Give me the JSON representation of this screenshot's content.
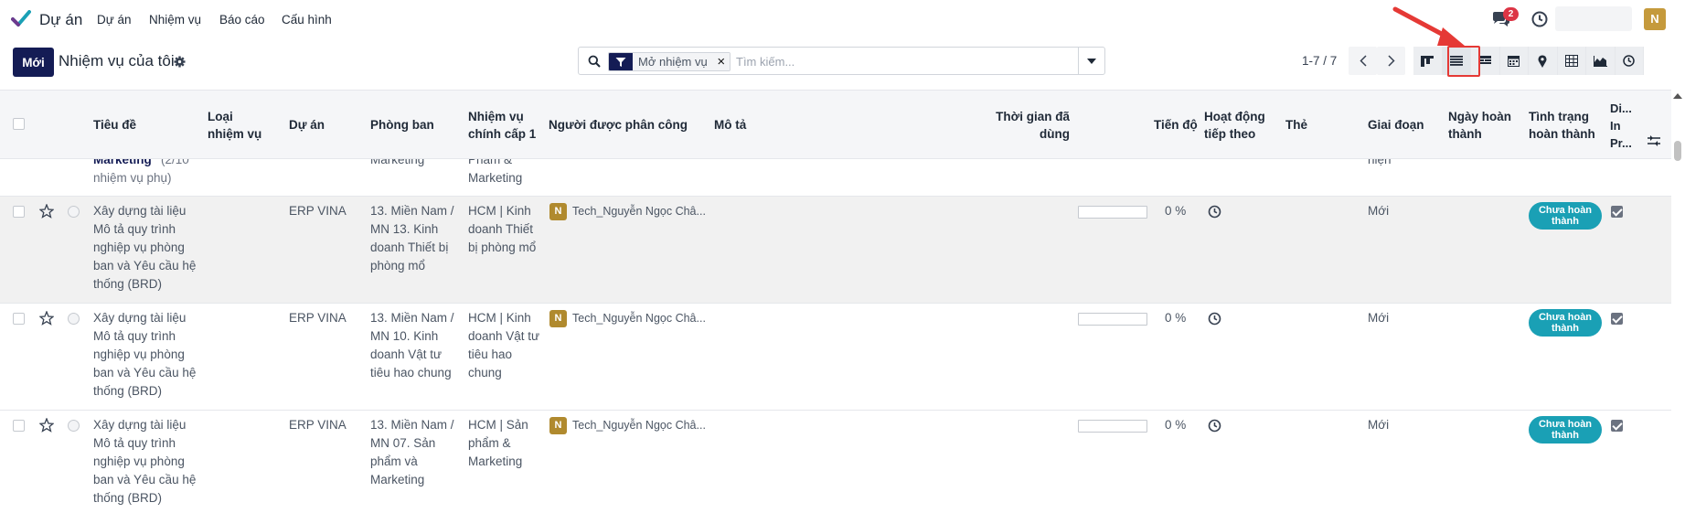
{
  "nav": {
    "app_name": "Dự án",
    "menus": [
      "Dự án",
      "Nhiệm vụ",
      "Báo cáo",
      "Cấu hình"
    ],
    "chat_count": "2",
    "user_initial": "N"
  },
  "control": {
    "new_label": "Mới",
    "title": "Nhiệm vụ của tôi",
    "facet_label": "Mở nhiệm vụ",
    "search_placeholder": "Tìm kiếm...",
    "pager": "1-7 / 7"
  },
  "views": [
    "kanban-icon",
    "list-icon",
    "activity-icon",
    "calendar-icon",
    "map-pin-icon",
    "pivot-icon",
    "graph-icon",
    "clock-icon"
  ],
  "columns": {
    "title": "Tiêu đề",
    "type": "Loại nhiệm vụ",
    "project": "Dự án",
    "department": "Phòng ban",
    "parent_task": "Nhiệm vụ chính cấp 1",
    "assignee": "Người được phân công",
    "description": "Mô tả",
    "time_spent": "Thời gian đã dùng",
    "progress": "Tiến độ",
    "next_activity": "Hoạt động tiếp theo",
    "tags": "Thẻ",
    "stage": "Giai đoạn",
    "done_date": "Ngày hoàn thành",
    "done_status": "Tình trạng hoàn thành",
    "extra": "Di... In Pr..."
  },
  "partial_row": {
    "title": "Marketing",
    "subtasks": "(2/10",
    "subtasks_2": "nhiệm vụ phụ)",
    "department": "Marketing",
    "parent_task_1": "Phẩm &",
    "parent_task_2": "Marketing",
    "stage": "hiện"
  },
  "rows": [
    {
      "title": [
        "Xây dựng tài liệu",
        "Mô tả quy trình",
        "nghiệp vụ phòng",
        "ban và Yêu cầu hệ",
        "thống (BRD)"
      ],
      "project": "ERP VINA",
      "department": [
        "13. Miền Nam /",
        "MN 13. Kinh",
        "doanh Thiết bị",
        "phòng mổ"
      ],
      "parent_task": [
        "HCM | Kinh",
        "doanh Thiết",
        "bị phòng mổ"
      ],
      "assignee_initial": "N",
      "assignee": "Tech_Nguyễn Ngọc Châ...",
      "progress": "0 %",
      "stage": "Mới",
      "status": "Chưa hoàn thành"
    },
    {
      "title": [
        "Xây dựng tài liệu",
        "Mô tả quy trình",
        "nghiệp vụ phòng",
        "ban và Yêu cầu hệ",
        "thống (BRD)"
      ],
      "project": "ERP VINA",
      "department": [
        "13. Miền Nam /",
        "MN 10. Kinh",
        "doanh Vật tư",
        "tiêu hao chung"
      ],
      "parent_task": [
        "HCM | Kinh",
        "doanh Vật tư",
        "tiêu hao",
        "chung"
      ],
      "assignee_initial": "N",
      "assignee": "Tech_Nguyễn Ngọc Châ...",
      "progress": "0 %",
      "stage": "Mới",
      "status": "Chưa hoàn thành"
    },
    {
      "title": [
        "Xây dựng tài liệu",
        "Mô tả quy trình",
        "nghiệp vụ phòng",
        "ban và Yêu cầu hệ",
        "thống (BRD)"
      ],
      "project": "ERP VINA",
      "department": [
        "13. Miền Nam /",
        "MN 07. Sản",
        "phẩm và",
        "Marketing"
      ],
      "parent_task": [
        "HCM | Sản",
        "phẩm &",
        "Marketing"
      ],
      "assignee_initial": "N",
      "assignee": "Tech_Nguyễn Ngọc Châ...",
      "progress": "0 %",
      "stage": "Mới",
      "status": "Chưa hoàn thành"
    }
  ]
}
